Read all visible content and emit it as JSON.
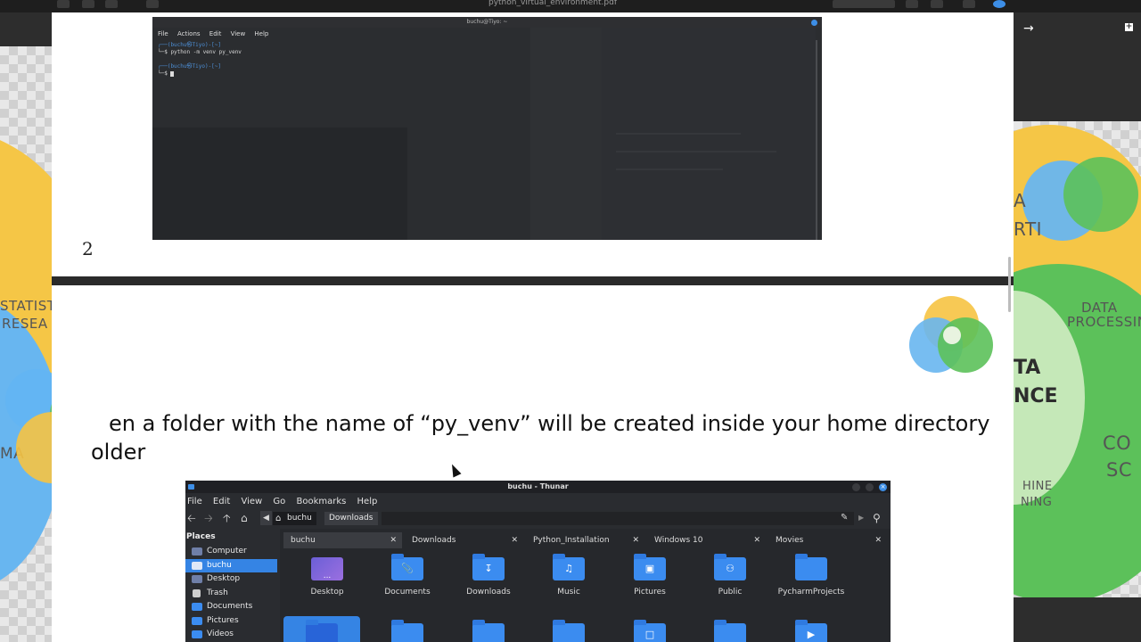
{
  "viewer": {
    "title": "python_virtual_environment.pdf"
  },
  "page": {
    "number": "2",
    "body_text": "en a folder with the name of “py_venv” will be created inside your home directory",
    "body_text_line2": "older"
  },
  "terminal": {
    "title": "buchu@Tiyo: ~",
    "menu": [
      "File",
      "Actions",
      "Edit",
      "View",
      "Help"
    ],
    "line1_prompt": "┌──(buchu㉿Tiyo)-[~]",
    "line1_cmd": "└─$ python -m venv py_venv",
    "line2_prompt": "┌──(buchu㉿Tiyo)-[~]",
    "line2_cmd": "└─$ "
  },
  "thunar": {
    "title": "buchu - Thunar",
    "menu": [
      "File",
      "Edit",
      "View",
      "Go",
      "Bookmarks",
      "Help"
    ],
    "path_home": "buchu",
    "path_current": "Downloads",
    "sidebar_heading": "Places",
    "sidebar": [
      "Computer",
      "buchu",
      "Desktop",
      "Trash",
      "Documents",
      "Pictures",
      "Videos"
    ],
    "tabs": [
      "buchu",
      "Downloads",
      "Python_Installation",
      "Windows 10",
      "Movies"
    ],
    "files_row1": [
      "Desktop",
      "Documents",
      "Downloads",
      "Music",
      "Pictures",
      "Public",
      "PycharmProjects"
    ]
  },
  "venn_left": {
    "label1": "STATISTI",
    "label2": "RESEA",
    "label3": "MA"
  },
  "venn_right": {
    "label1": "A",
    "label2": "RTI",
    "label3": "DATA",
    "label4": "PROCESSIN",
    "label5": "TA",
    "label6": "NCE",
    "label7": "CO",
    "label8": "SC",
    "label9": "HINE",
    "label10": "NING"
  },
  "colors": {
    "accent": "#3584e4",
    "folder": "#3b8cf0",
    "venn_orange": "#f6c343",
    "venn_green": "#5cc15a",
    "venn_blue": "#5ab0f0"
  }
}
